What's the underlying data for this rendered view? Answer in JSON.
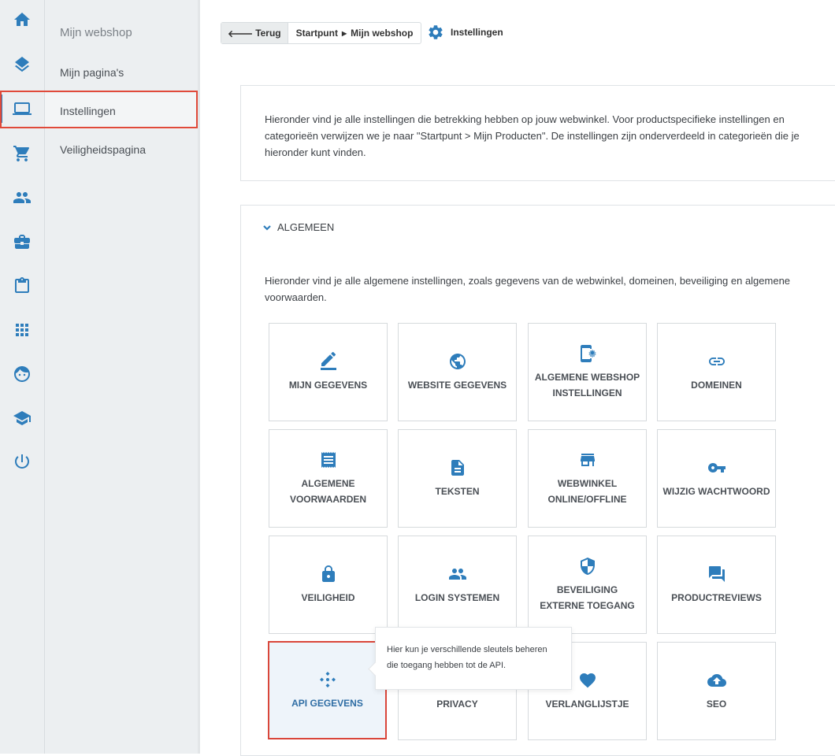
{
  "rail": {
    "items": [
      {
        "icon": "home-icon"
      },
      {
        "icon": "layers-icon"
      },
      {
        "icon": "laptop-icon"
      },
      {
        "icon": "cart-icon"
      },
      {
        "icon": "people-icon"
      },
      {
        "icon": "briefcase-icon"
      },
      {
        "icon": "clipboard-icon"
      },
      {
        "icon": "apps-grid-icon"
      },
      {
        "icon": "face-icon"
      },
      {
        "icon": "school-icon"
      },
      {
        "icon": "power-icon"
      }
    ]
  },
  "subnav": {
    "items": [
      {
        "label": "Mijn webshop"
      },
      {
        "label": "Mijn pagina's"
      },
      {
        "label": "Instellingen"
      },
      {
        "label": "Veiligheidspagina"
      }
    ]
  },
  "topbar": {
    "back_label": "Terug",
    "crumb_1": "Startpunt",
    "crumb_2": "Mijn webshop",
    "title": "Instellingen"
  },
  "intro": {
    "text": "Hieronder vind je alle instellingen die betrekking hebben op jouw webwinkel. Voor productspecifieke instellingen en categorieën verwijzen we je naar \"Startpunt > Mijn Producten\". De instellingen zijn onderverdeeld in categorieën die je hieronder kunt vinden."
  },
  "section": {
    "title": "ALGEMEEN",
    "description": "Hieronder vind je alle algemene instellingen, zoals gegevens van de webwinkel, domeinen, beveiliging en algemene voorwaarden."
  },
  "tiles": [
    {
      "label": "MIJN GEGEVENS",
      "icon": "edit-icon"
    },
    {
      "label": "WEBSITE GEGEVENS",
      "icon": "globe-icon"
    },
    {
      "label": "ALGEMENE WEBSHOP INSTELLINGEN",
      "icon": "phone-settings-icon"
    },
    {
      "label": "DOMEINEN",
      "icon": "link-icon"
    },
    {
      "label": "ALGEMENE VOORWAARDEN",
      "icon": "receipt-icon"
    },
    {
      "label": "TEKSTEN",
      "icon": "document-icon"
    },
    {
      "label": "WEBWINKEL ONLINE/OFFLINE",
      "icon": "store-icon"
    },
    {
      "label": "WIJZIG WACHTWOORD",
      "icon": "key-icon"
    },
    {
      "label": "VEILIGHEID",
      "icon": "lock-icon"
    },
    {
      "label": "LOGIN SYSTEMEN",
      "icon": "people-icon"
    },
    {
      "label": "BEVEILIGING EXTERNE TOEGANG",
      "icon": "shield-icon"
    },
    {
      "label": "PRODUCTREVIEWS",
      "icon": "chat-icon"
    },
    {
      "label": "API GEGEVENS",
      "icon": "api-icon"
    },
    {
      "label": "PRIVACY",
      "icon": "privacy-icon"
    },
    {
      "label": "VERLANGLIJSTJE",
      "icon": "heart-icon"
    },
    {
      "label": "SEO",
      "icon": "cloud-upload-icon"
    }
  ],
  "tooltip": {
    "text": "Hier kun je verschillende sleutels beheren die toegang hebben tot de API."
  },
  "colors": {
    "accent": "#2e7dbb",
    "highlight_border": "#d9463a"
  }
}
